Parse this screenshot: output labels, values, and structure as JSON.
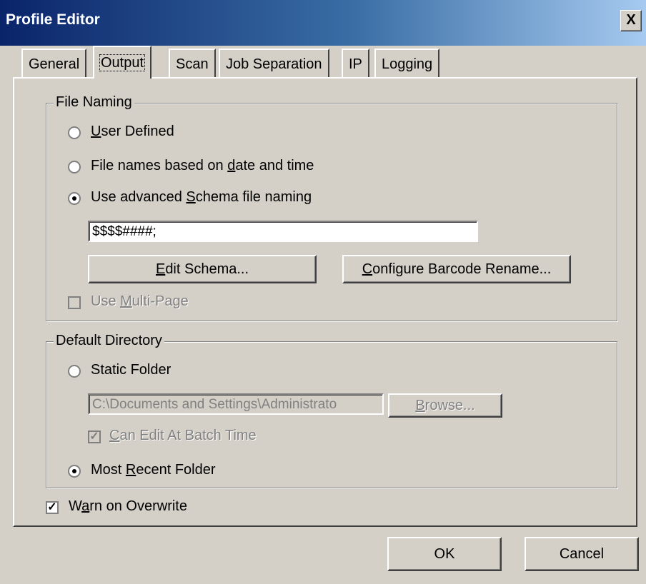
{
  "window": {
    "title": "Profile Editor",
    "close_glyph": "X"
  },
  "tabs": [
    {
      "label": "General",
      "active": false
    },
    {
      "label": "Output",
      "active": true
    },
    {
      "label": "Scan",
      "active": false
    },
    {
      "label": "Job Separation",
      "active": false
    },
    {
      "label": "IP",
      "active": false
    },
    {
      "label": "Logging",
      "active": false
    }
  ],
  "file_naming": {
    "legend": "File Naming",
    "options": [
      {
        "label": "User Defined",
        "selected": false
      },
      {
        "label": "File names based on date and time",
        "selected": false
      },
      {
        "label": "Use advanced Schema file naming",
        "selected": true
      }
    ],
    "schema_value": "$$$$####;",
    "edit_schema_label": "Edit Schema...",
    "configure_barcode_label": "Configure Barcode Rename...",
    "multipage_label": "Use Multi-Page",
    "multipage_checked": false,
    "multipage_disabled": true
  },
  "default_directory": {
    "legend": "Default Directory",
    "static_folder_label": "Static Folder",
    "static_folder_selected": false,
    "path_value": "C:\\Documents and Settings\\Administrato",
    "browse_label": "Browse...",
    "edit_at_batch_label": "Can Edit At Batch Time",
    "edit_at_batch_checked": true,
    "most_recent_label": "Most Recent Folder",
    "most_recent_selected": true
  },
  "warn_overwrite": {
    "label": "Warn on Overwrite",
    "checked": true
  },
  "buttons": {
    "ok_label": "OK",
    "cancel_label": "Cancel"
  },
  "colors": {
    "face": "#d4d0c8",
    "title_start": "#0a246a",
    "title_end": "#a6caf0",
    "disabled_text": "#808080"
  }
}
